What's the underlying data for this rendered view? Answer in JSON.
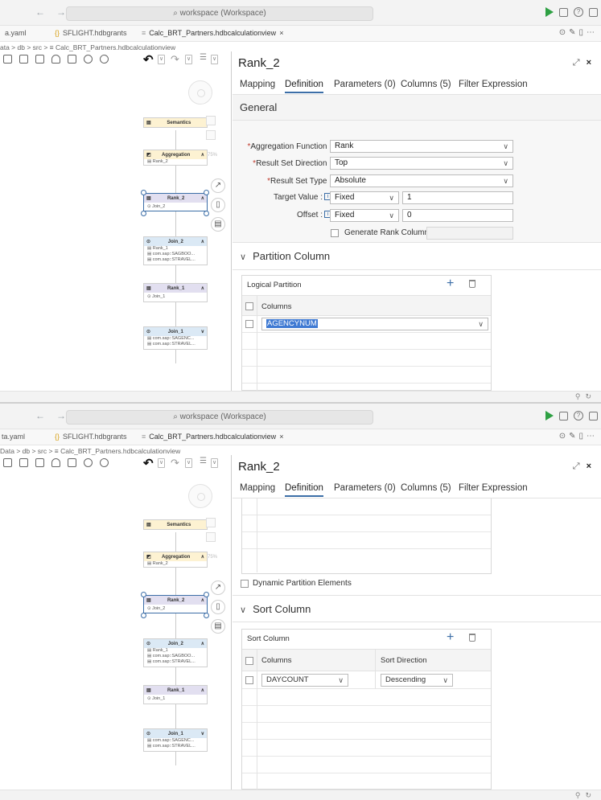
{
  "window": {
    "search_text": "workspace (Workspace)"
  },
  "tabs": [
    {
      "label": "a.yaml"
    },
    {
      "label": "SFLIGHT.hdbgrants"
    },
    {
      "label": "Calc_BRT_Partners.hdbcalculationview",
      "close": "×"
    }
  ],
  "tabs2": [
    {
      "label": "ta.yaml"
    },
    {
      "label": "SFLIGHT.hdbgrants"
    },
    {
      "label": "Calc_BRT_Partners.hdbcalculationview",
      "close": "×"
    }
  ],
  "breadcrumb": "ata > db > src > ≡ Calc_BRT_Partners.hdbcalculationview",
  "breadcrumb2": "Data > db > src > ≡ Calc_BRT_Partners.hdbcalculationview",
  "diagram": {
    "semantics": "Semantics",
    "aggregation": {
      "name": "Aggregation",
      "input": "Rank_2",
      "percent": "75%"
    },
    "rank2": {
      "name": "Rank_2",
      "input": "Join_2"
    },
    "join2": {
      "name": "Join_2",
      "inputs": [
        "Rank_1",
        "com.sap::SAGBOO...",
        "com.sap::STRAVEL..."
      ]
    },
    "rank1": {
      "name": "Rank_1",
      "input": "Join_1"
    },
    "join1": {
      "name": "Join_1",
      "inputs": [
        "com.sap::SAGENC...",
        "com.sap::STRAVEL..."
      ]
    }
  },
  "panel": {
    "title": "Rank_2",
    "tabs": [
      "Mapping",
      "Definition",
      "Parameters (0)",
      "Columns (5)",
      "Filter Expression"
    ],
    "general": {
      "title": "General",
      "aggregation_function_label": "Aggregation Function :",
      "aggregation_function": "Rank",
      "result_set_direction_label": "Result Set Direction :",
      "result_set_direction": "Top",
      "result_set_type_label": "Result Set Type :",
      "result_set_type": "Absolute",
      "target_value_label": "Target Value :",
      "target_value_type": "Fixed",
      "target_value": "1",
      "offset_label": "Offset :",
      "offset_type": "Fixed",
      "offset": "0",
      "generate_rank_column_label": "Generate Rank Column :"
    },
    "partition": {
      "title": "Partition Column",
      "table_title": "Logical Partition",
      "col_header": "Columns",
      "rows": [
        "AGENCYNUM"
      ],
      "dynamic_label": "Dynamic Partition Elements"
    },
    "sort": {
      "title": "Sort Column",
      "table_title": "Sort Column",
      "col_header": "Columns",
      "dir_header": "Sort Direction",
      "rows": [
        {
          "column": "DAYCOUNT",
          "direction": "Descending"
        }
      ]
    }
  },
  "icons": {
    "search": "⌕",
    "dropdown": "∨",
    "chevron": "∨",
    "plus": "+",
    "close": "×",
    "info": "i",
    "expand": "⤢"
  }
}
